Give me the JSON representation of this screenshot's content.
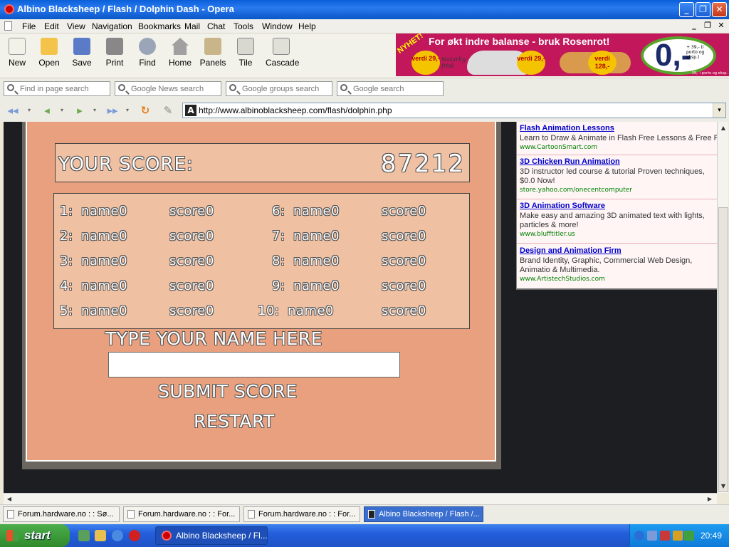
{
  "window": {
    "title": "Albino Blacksheep / Flash / Dolphin Dash - Opera",
    "minimize": "_",
    "maximize": "❐",
    "close": "✕"
  },
  "menu": {
    "items": [
      "File",
      "Edit",
      "View",
      "Navigation",
      "Bookmarks",
      "Mail",
      "Chat",
      "Tools",
      "Window",
      "Help"
    ],
    "mdi_minimize": "_",
    "mdi_restore": "❐",
    "mdi_close": "✕"
  },
  "toolbar": {
    "buttons": [
      {
        "label": "New",
        "icon": "new-page-icon",
        "color": "#f2f2e8"
      },
      {
        "label": "Open",
        "icon": "folder-icon",
        "color": "#f4c44a"
      },
      {
        "label": "Save",
        "icon": "floppy-icon",
        "color": "#5a7cc8"
      },
      {
        "label": "Print",
        "icon": "printer-icon",
        "color": "#888888"
      },
      {
        "label": "Find",
        "icon": "magnifier-icon",
        "color": "#9aa6b8"
      },
      {
        "label": "Home",
        "icon": "home-icon",
        "color": "#a0a0a0"
      },
      {
        "label": "Panels",
        "icon": "panels-icon",
        "color": "#c8b68a"
      },
      {
        "label": "Tile",
        "icon": "tile-icon",
        "color": "#d8d8d0"
      },
      {
        "label": "Cascade",
        "icon": "cascade-icon",
        "color": "#e0e0d8"
      }
    ]
  },
  "banner": {
    "tag": "NYHET!",
    "headline": "For økt indre balanse - bruk Rosenrot!",
    "product": "Naturlig frisk",
    "badges": [
      {
        "text": "verdi 29,-"
      },
      {
        "text": "verdi 29,-"
      },
      {
        "text": "verdi 128,-"
      }
    ],
    "price": "0,-",
    "price_note": "+ 39,- (i porto og eksp.)",
    "footer": "39,- i porto og eksp."
  },
  "search": {
    "fields": [
      {
        "placeholder": "Find in page search"
      },
      {
        "placeholder": "Google News search"
      },
      {
        "placeholder": "Google groups search"
      },
      {
        "placeholder": "Google search"
      }
    ]
  },
  "address": {
    "url": "http://www.albinoblacksheep.com/flash/dolphin.php",
    "site_icon": "A"
  },
  "nav": {
    "rewind": "◂◂",
    "back": "◂",
    "forward": "▸",
    "fast_forward": "▸▸",
    "reload": "↻",
    "edit": "✎",
    "drop": "▾"
  },
  "game": {
    "score_label": "YOUR SCORE:",
    "score_value": "87212",
    "highscores": [
      {
        "rank": "1:",
        "name": "name0",
        "score": "score0"
      },
      {
        "rank": "2:",
        "name": "name0",
        "score": "score0"
      },
      {
        "rank": "3:",
        "name": "name0",
        "score": "score0"
      },
      {
        "rank": "4:",
        "name": "name0",
        "score": "score0"
      },
      {
        "rank": "5:",
        "name": "name0",
        "score": "score0"
      },
      {
        "rank": "6:",
        "name": "name0",
        "score": "score0"
      },
      {
        "rank": "7:",
        "name": "name0",
        "score": "score0"
      },
      {
        "rank": "8:",
        "name": "name0",
        "score": "score0"
      },
      {
        "rank": "9:",
        "name": "name0",
        "score": "score0"
      },
      {
        "rank": "10:",
        "name": "name0",
        "score": "score0"
      }
    ],
    "name_prompt": "TYPE YOUR NAME HERE",
    "name_value": "",
    "submit_label": "SUBMIT SCORE",
    "restart_label": "RESTART"
  },
  "ads": [
    {
      "title": "Flash Animation Lessons",
      "desc": "Learn to Draw & Animate in Flash Free Lessons & Free F",
      "url": "www.CartoonSmart.com"
    },
    {
      "title": "3D Chicken Run Animation",
      "desc": "3D instructor led course & tutorial Proven techniques, $0.0 Now!",
      "url": "store.yahoo.com/onecentcomputer"
    },
    {
      "title": "3D Animation Software",
      "desc": "Make easy and amazing 3D animated text with lights, particles & more!",
      "url": "www.blufftitler.us"
    },
    {
      "title": "Design and Animation Firm",
      "desc": "Brand Identity, Graphic, Commercial Web Design, Animatio & Multimedia.",
      "url": "www.ArtistechStudios.com"
    }
  ],
  "scroll": {
    "up": "▲",
    "down": "▼",
    "left": "◀",
    "right": "▶"
  },
  "tabs": [
    {
      "label": "Forum.hardware.no : : Sø..."
    },
    {
      "label": "Forum.hardware.no : : For..."
    },
    {
      "label": "Forum.hardware.no : : For..."
    },
    {
      "label": "Albino Blacksheep / Flash /..."
    }
  ],
  "taskbar": {
    "start_label": "start",
    "task_label": "Albino Blacksheep / Fl...",
    "clock": "20:49",
    "tray_icons": [
      {
        "icon": "arrow-icon",
        "color": "#2a6fd8"
      },
      {
        "icon": "network-icon",
        "color": "#7a9ad8"
      },
      {
        "icon": "security-icon",
        "color": "#c83a3a"
      },
      {
        "icon": "zonealarm-icon",
        "color": "#d8a020"
      },
      {
        "icon": "volume-icon",
        "color": "#40a040"
      }
    ],
    "quicklaunch": [
      {
        "icon": "desktop-icon",
        "color": "#5aa05a"
      },
      {
        "icon": "explorer-icon",
        "color": "#e8c050"
      },
      {
        "icon": "ie-icon",
        "color": "#4a8ae0"
      },
      {
        "icon": "opera-icon",
        "color": "#d02020"
      }
    ]
  }
}
